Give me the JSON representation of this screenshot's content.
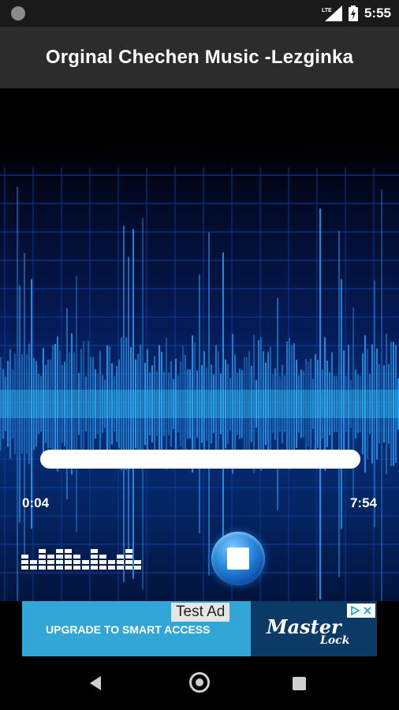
{
  "status_bar": {
    "time": "5:55",
    "network": "LTE",
    "icons": [
      "notification-dot-icon",
      "lte-signal-icon",
      "battery-charging-icon"
    ]
  },
  "app": {
    "title": "Orginal Chechen Music -Lezginka"
  },
  "player": {
    "current_time": "0:04",
    "total_time": "7:54",
    "progress": 0.008,
    "state": "playing",
    "icons": [
      "equalizer-icon",
      "stop-icon"
    ]
  },
  "ad": {
    "test_label": "Test Ad",
    "headline": "UPGRADE TO SMART ACCESS",
    "brand_main": "Master",
    "brand_sub": "Lock",
    "icons": [
      "ad-choices-icon"
    ]
  },
  "nav_bar": {
    "icons": [
      "back-icon",
      "home-icon",
      "recents-icon"
    ]
  },
  "colors": {
    "app_bar": "#2c2c2c",
    "status_bar": "#1a1a1a",
    "ad_background": "#32a6d6",
    "ad_brand_background": "#0b3a66",
    "wave": "#2aa9ff"
  }
}
